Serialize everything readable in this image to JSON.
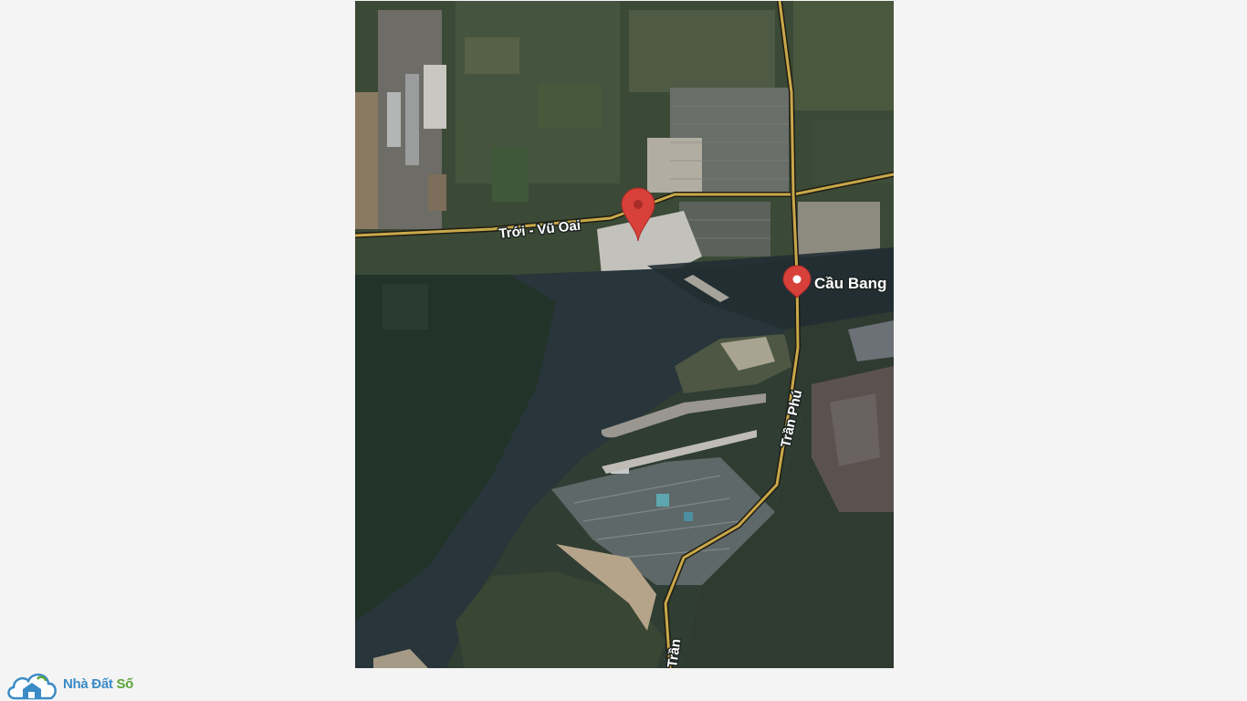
{
  "map": {
    "labels": {
      "poi_cau_bang": "Cầu Bang",
      "road_troi_vu_oai": "Trới - Vũ Oai",
      "road_tran_phu": "Trần Phú",
      "road_tran_bottom": "Trần"
    },
    "markers": [
      {
        "name": "marker-project-site",
        "color": "#d8403a"
      },
      {
        "name": "marker-cau-bang",
        "color": "#d8403a"
      }
    ]
  },
  "brand": {
    "name_part1": "Nhà Đất ",
    "name_part2": "Số",
    "colors": {
      "primary": "#3a8bc6",
      "secondary": "#5aa63a"
    }
  }
}
